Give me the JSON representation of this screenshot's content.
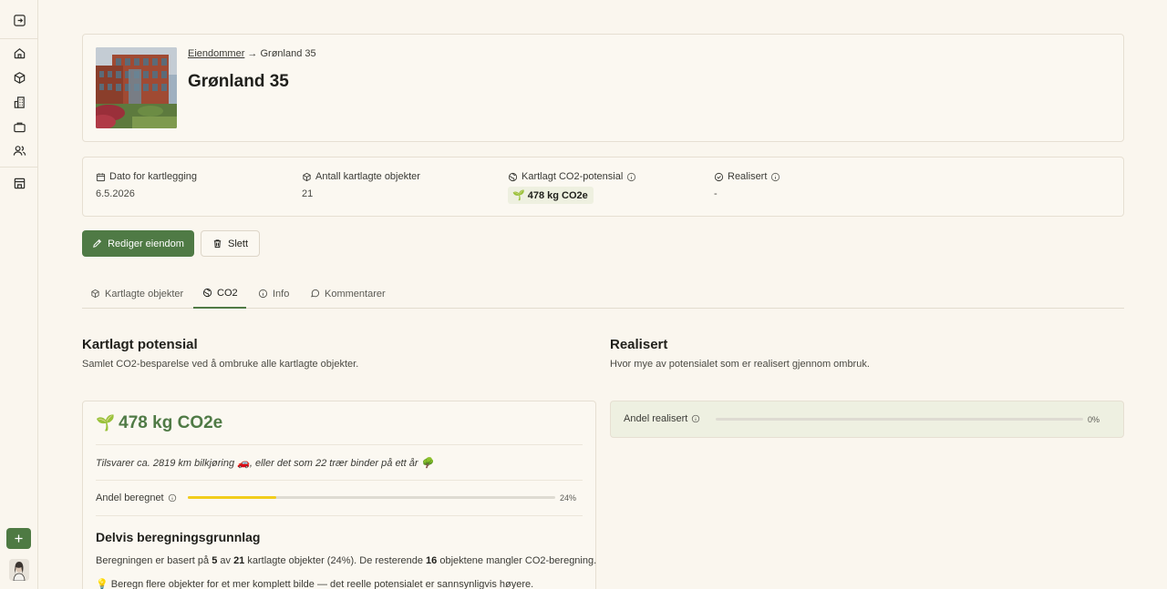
{
  "breadcrumb": {
    "parent": "Eiendommer",
    "arrow": "→",
    "current": "Grønland 35"
  },
  "property": {
    "title": "Grønland 35"
  },
  "stats": {
    "date": {
      "label": "Dato for kartlegging",
      "value": "6.5.2026"
    },
    "objects": {
      "label": "Antall kartlagte objekter",
      "value": "21"
    },
    "potential": {
      "label": "Kartlagt CO2-potensial",
      "value": "478 kg CO2e"
    },
    "realized": {
      "label": "Realisert",
      "value": "-"
    }
  },
  "actions": {
    "edit_label": "Rediger eiendom",
    "delete_label": "Slett"
  },
  "tabs": [
    {
      "label": "Kartlagte objekter",
      "icon": "box-icon",
      "active": false
    },
    {
      "label": "CO2",
      "icon": "globe-icon",
      "active": true
    },
    {
      "label": "Info",
      "icon": "info-icon",
      "active": false
    },
    {
      "label": "Kommentarer",
      "icon": "chat-icon",
      "active": false
    }
  ],
  "potential_section": {
    "title": "Kartlagt potensial",
    "subtitle": "Samlet CO2-besparelse ved å ombruke alle kartlagte objekter.",
    "amount": "478 kg CO2e",
    "equivalent": "Tilsvarer ca. 2819 km bilkjøring 🚗, eller det som 22 trær binder på ett år 🌳",
    "progress_label": "Andel beregnet",
    "progress_value": 0.24,
    "progress_text": "24%",
    "progress_color": "#f2cd1c",
    "basis_title": "Delvis beregningsgrunnlag",
    "basis_text": {
      "p1": "Beregningen er basert på ",
      "n1": "5",
      "p2": " av ",
      "n2": "21",
      "p3": " kartlagte objekter (24%). De resterende ",
      "n3": "16",
      "p4": " objektene mangler CO2-beregning."
    },
    "hint": "💡 Beregn flere objekter for et mer komplett bilde — det reelle potensialet er sannsynligvis høyere."
  },
  "realized_section": {
    "title": "Realisert",
    "subtitle": "Hvor mye av potensialet som er realisert gjennom ombruk.",
    "progress_label": "Andel realisert",
    "progress_value": 0,
    "progress_text": "0%"
  },
  "colors": {
    "accent": "#4f7a45",
    "background": "#faf6ee",
    "realized_bg": "#eef0e1"
  }
}
